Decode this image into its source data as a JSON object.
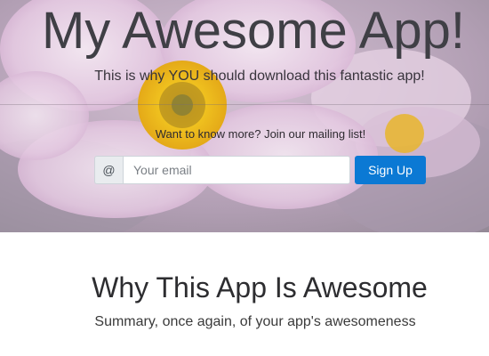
{
  "hero": {
    "title": "My Awesome App!",
    "subtitle": "This is why YOU should download this fantastic app!",
    "background_image": "pink-anemone-flower-photo",
    "mailing_text": "Want to know more? Join our mailing list!"
  },
  "signup": {
    "addon": "@",
    "email_placeholder": "Your email",
    "email_value": "",
    "button_label": "Sign Up",
    "accent_color": "#0b79d4"
  },
  "section": {
    "title": "Why This App Is Awesome",
    "subtitle": "Summary, once again, of your app's awesomeness"
  }
}
